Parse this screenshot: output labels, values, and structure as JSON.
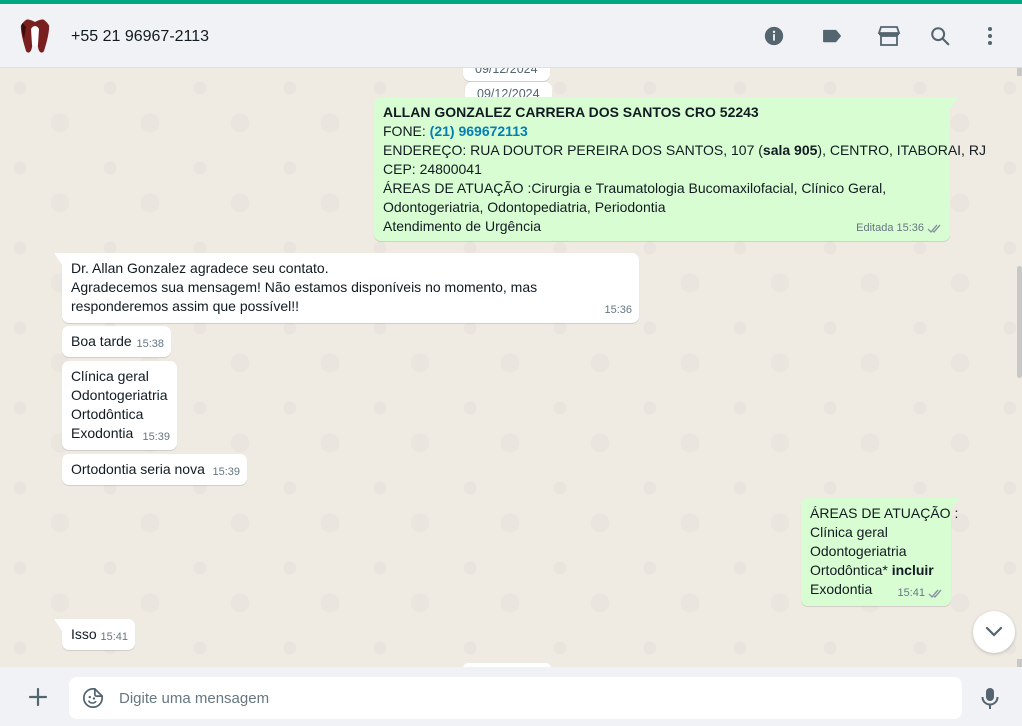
{
  "header": {
    "contact": "+55 21 96967-2113",
    "icons": [
      "info-icon",
      "label-icon",
      "catalog-icon",
      "search-icon",
      "menu-icon"
    ]
  },
  "chat": {
    "partial_date": "09/12/2024",
    "date_chip": "09/12/2024",
    "msg1": {
      "title": "ALLAN GONZALEZ CARRERA DOS SANTOS CRO 52243",
      "phone_label": "FONE: ",
      "phone": "(21) 969672113",
      "address_pre": "ENDEREÇO: RUA DOUTOR PEREIRA DOS SANTOS, 107 (",
      "address_bold": "sala 905",
      "address_post": "), CENTRO, ITABORAI, RJ",
      "cep": "CEP: 24800041",
      "areas_1": "ÁREAS DE ATUAÇÃO :Cirurgia e Traumatologia Bucomaxilofacial, Clínico Geral,",
      "areas_2": "Odontogeriatria, Odontopediatria, Periodontia",
      "areas_3": "Atendimento de Urgência",
      "edited": "Editada",
      "time": "15:36"
    },
    "msg2": {
      "line1": "Dr. Allan Gonzalez agradece seu contato.",
      "line2": "Agradecemos sua mensagem! Não estamos disponíveis no momento, mas",
      "line3": "responderemos assim que possível!!",
      "time": "15:36"
    },
    "msg3": {
      "text": "Boa tarde",
      "time": "15:38"
    },
    "msg4": {
      "line1": "Clínica geral",
      "line2": "Odontogeriatria",
      "line3": "Ortodôntica",
      "line4": "Exodontia",
      "time": "15:39"
    },
    "msg5": {
      "text": "Ortodontia seria nova",
      "time": "15:39"
    },
    "msg6": {
      "line1": "ÁREAS DE ATUAÇÃO :",
      "line2": "Clínica geral",
      "line3": "Odontogeriatria",
      "line4_pre": "Ortodôntica* ",
      "line4_bold": "incluir",
      "line5": "Exodontia",
      "time": "15:41"
    },
    "msg7": {
      "text": "Isso",
      "time": "15:41"
    }
  },
  "composer": {
    "placeholder": "Digite uma mensagem"
  },
  "colors": {
    "accent": "#00a884",
    "outgoing": "#d9fdd3",
    "incoming": "#ffffff",
    "background": "#efeae2",
    "link": "#027eb5"
  }
}
